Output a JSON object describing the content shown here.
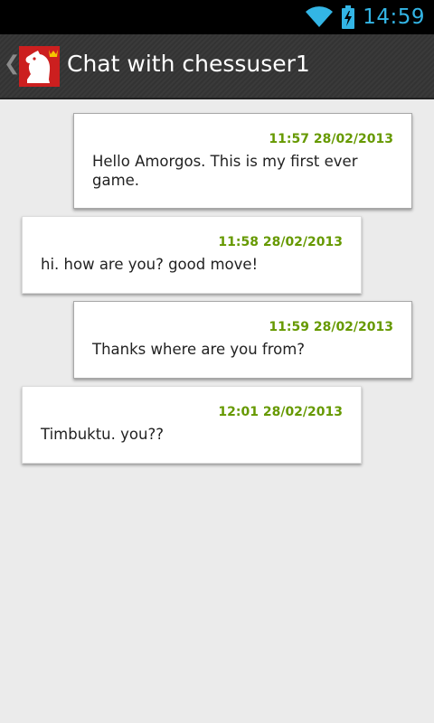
{
  "status_bar": {
    "time": "14:59",
    "wifi_icon": "wifi-icon",
    "battery_icon": "battery-charging-icon",
    "accent_color": "#33b5e5"
  },
  "action_bar": {
    "title": "Chat with chessuser1",
    "up_icon": "chevron-left-icon",
    "app_icon": "chess-knight-crown-icon",
    "app_icon_color": "#cc1f1f"
  },
  "messages": [
    {
      "direction": "outgoing",
      "time": "11:57 28/02/2013",
      "text": "Hello Amorgos. This is my first ever game."
    },
    {
      "direction": "incoming",
      "time": "11:58 28/02/2013",
      "text": "hi. how are you? good move!"
    },
    {
      "direction": "outgoing",
      "time": "11:59 28/02/2013",
      "text": "Thanks where are you from?"
    },
    {
      "direction": "incoming",
      "time": "12:01 28/02/2013",
      "text": "Timbuktu. you??"
    }
  ],
  "colors": {
    "timestamp": "#669900",
    "background": "#ebebeb"
  }
}
